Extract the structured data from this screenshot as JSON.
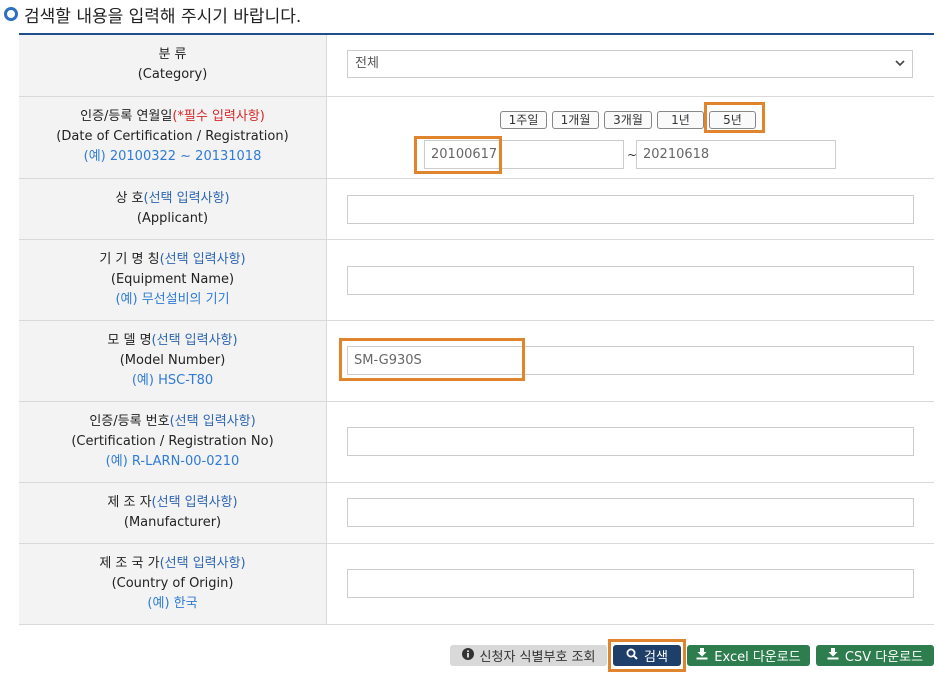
{
  "heading": "검색할 내용을 입력해 주시기 바랍니다.",
  "rows": {
    "category": {
      "label_ko": "분 류",
      "label_en": "(Category)",
      "select_value": "전체"
    },
    "date": {
      "label_ko": "인증/등록 연월일",
      "required": "(*필수 입력사항)",
      "label_en": "(Date of Certification / Registration)",
      "example": "(예) 20100322 ~ 20131018",
      "periods": [
        "1주일",
        "1개월",
        "3개월",
        "1년",
        "5년"
      ],
      "from": "20100617",
      "tilde": "~",
      "to": "20210618"
    },
    "applicant": {
      "label_ko": "상 호",
      "optional": "(선택 입력사항)",
      "label_en": "(Applicant)",
      "value": ""
    },
    "equipment": {
      "label_ko": "기 기 명 칭",
      "optional": "(선택 입력사항)",
      "label_en": "(Equipment Name)",
      "example": "(예) 무선설비의 기기",
      "value": ""
    },
    "model": {
      "label_ko": "모 델 명",
      "optional": "(선택 입력사항)",
      "label_en": "(Model Number)",
      "example": "(예) HSC-T80",
      "value": "SM-G930S"
    },
    "cert_no": {
      "label_ko": "인증/등록 번호",
      "optional": "(선택 입력사항)",
      "label_en": "(Certification / Registration No)",
      "example": "(예) R-LARN-00-0210",
      "value": ""
    },
    "manufacturer": {
      "label_ko": "제 조 자",
      "optional": "(선택 입력사항)",
      "label_en": "(Manufacturer)",
      "value": ""
    },
    "country": {
      "label_ko": "제 조 국 가",
      "optional": "(선택 입력사항)",
      "label_en": "(Country of Origin)",
      "example": "(예) 한국",
      "value": ""
    }
  },
  "buttons": {
    "applicant_id": "신청자 식별부호 조회",
    "search": "검색",
    "excel": "Excel 다운로드",
    "csv": "CSV 다운로드"
  },
  "icons": {
    "info": "info-icon",
    "search": "search-icon",
    "download": "download-icon"
  },
  "colors": {
    "accent_line": "#1e4f8c",
    "highlight": "#e0842e",
    "search_button": "#1f3f6b",
    "download_button": "#2e7d4f",
    "gray_button": "#d8d8d8"
  }
}
